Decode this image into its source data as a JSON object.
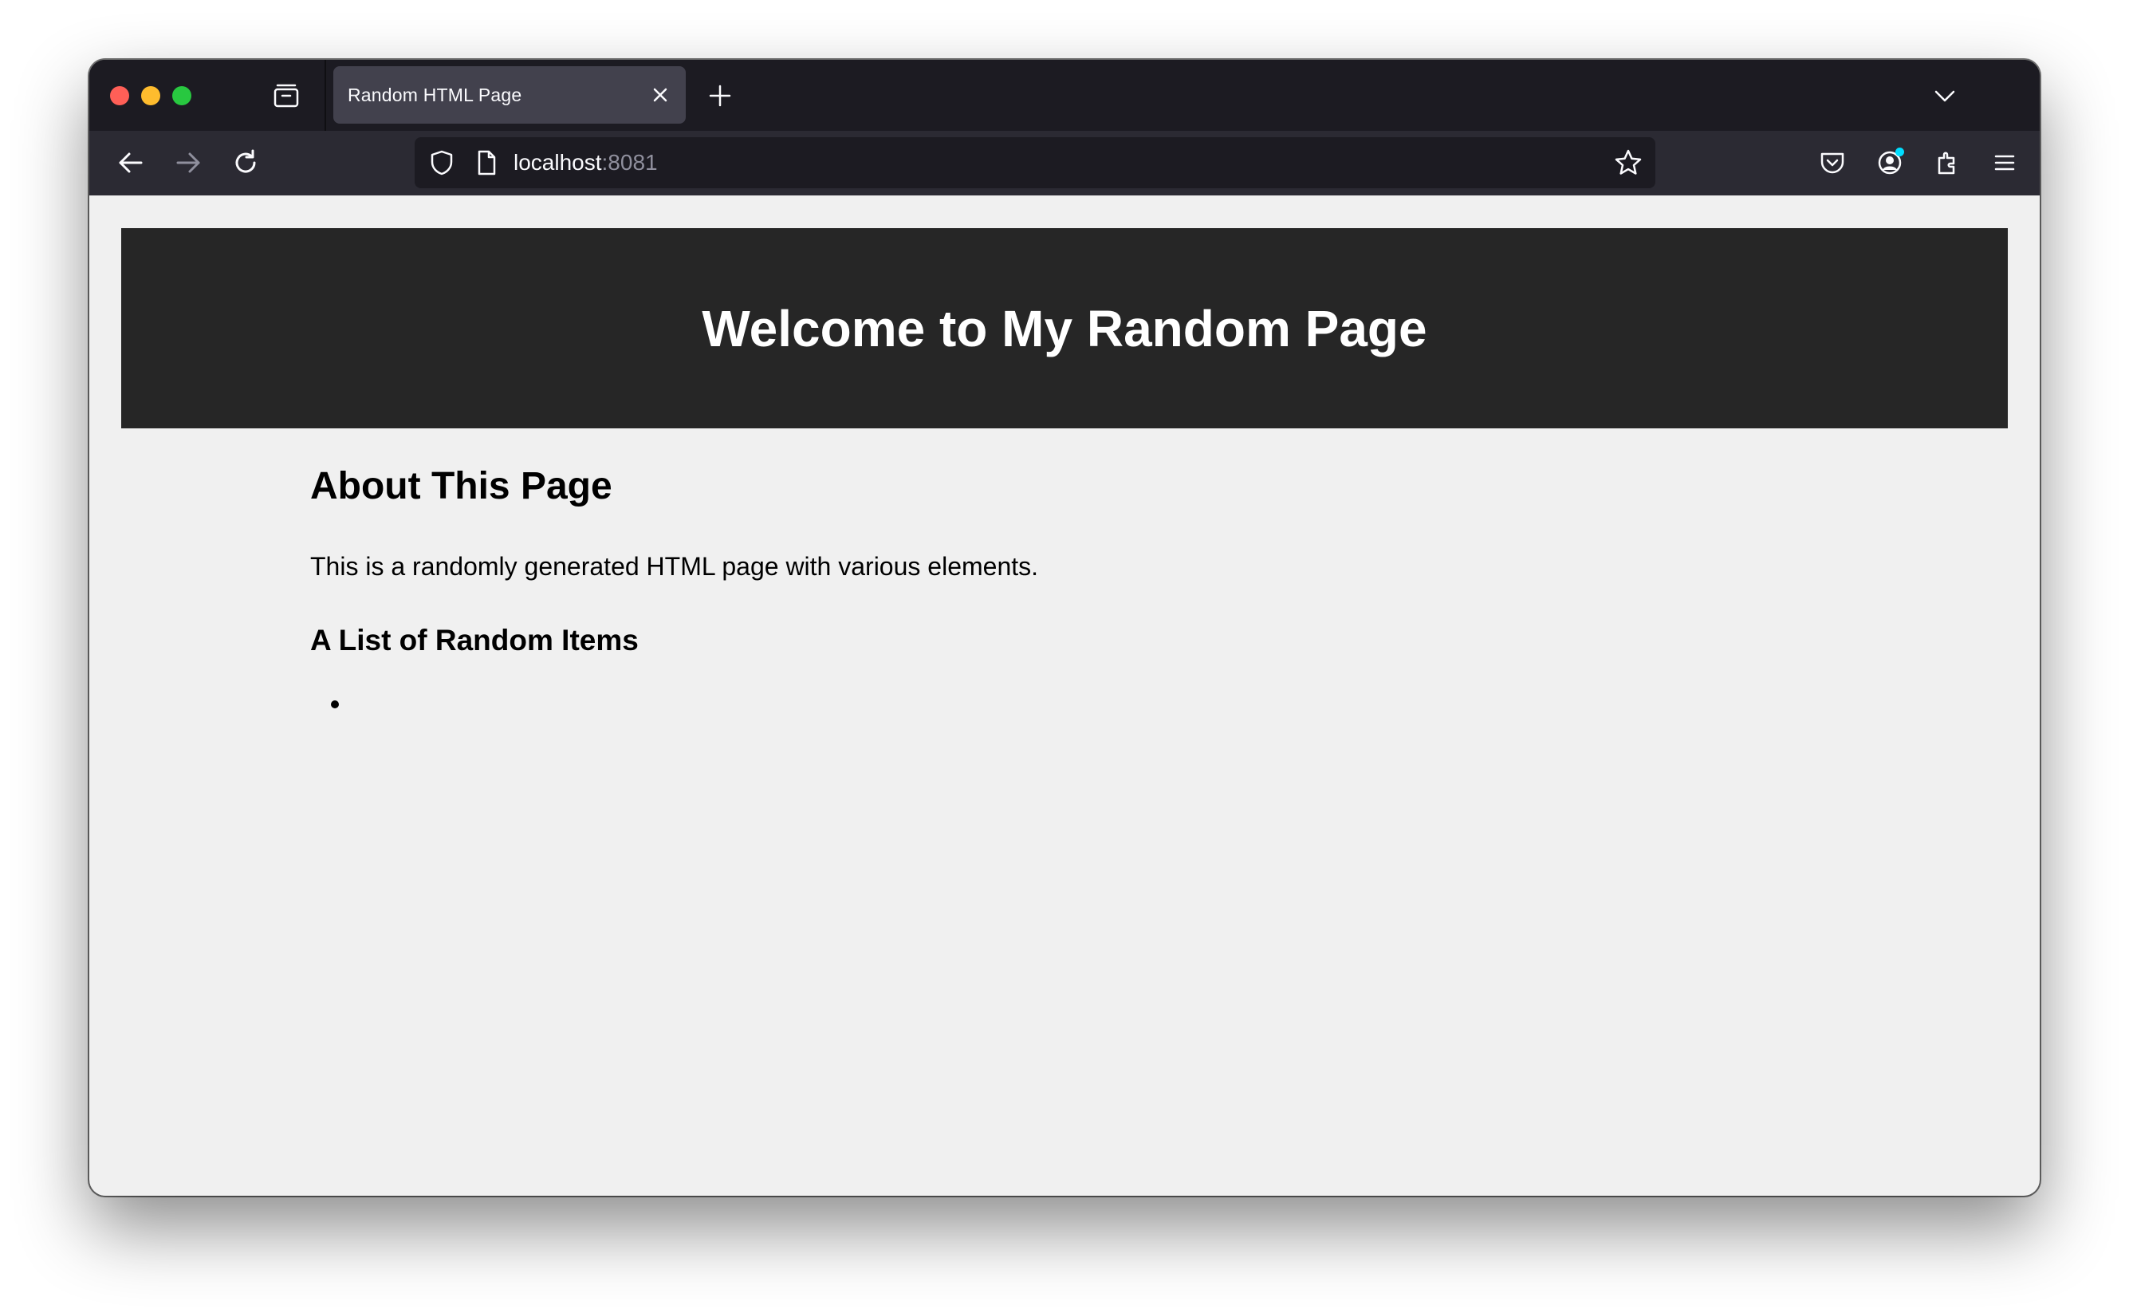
{
  "browser": {
    "tab": {
      "title": "Random HTML Page"
    },
    "url": {
      "host": "localhost",
      "port": ":8081"
    }
  },
  "page": {
    "banner_title": "Welcome to My Random Page",
    "about_heading": "About This Page",
    "about_text": "This is a randomly generated HTML page with various elements.",
    "list_heading": "A List of Random Items",
    "list_items": [
      ""
    ]
  },
  "colors": {
    "window_chrome": "#1c1b22",
    "toolbar": "#2b2a33",
    "active_tab": "#42414d",
    "banner_bg": "#262626",
    "page_bg": "#f0f0f0",
    "notification_dot": "#00ddff"
  },
  "icons": [
    "close-window-icon",
    "minimize-window-icon",
    "zoom-window-icon",
    "tab-overview-icon",
    "tab-close-icon",
    "new-tab-icon",
    "tab-list-chevron-icon",
    "back-arrow-icon",
    "forward-arrow-icon",
    "reload-icon",
    "shield-icon",
    "page-icon",
    "bookmark-star-icon",
    "pocket-icon",
    "account-icon",
    "extensions-icon",
    "menu-icon"
  ]
}
